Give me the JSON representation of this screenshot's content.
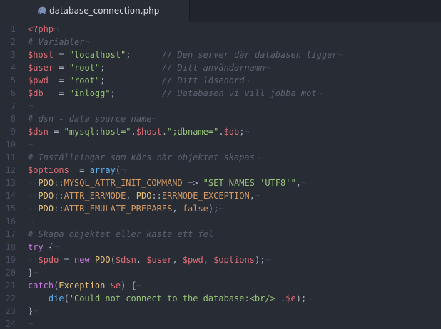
{
  "colors": {
    "background": "#282c34",
    "tabbar": "#21252b",
    "line_number": "#495162",
    "variable": "#e06c75",
    "string": "#98c379",
    "comment": "#5c6370",
    "keyword": "#c678dd",
    "function": "#61afef",
    "class": "#e5c07b",
    "constant": "#d19a66",
    "plain": "#abb2bf",
    "invisible": "#3b4048"
  },
  "tab": {
    "icon": "php-elephant-icon",
    "title": "database_connection.php"
  },
  "editor": {
    "eol_marker": "¬",
    "lines": [
      {
        "n": "1",
        "tokens": [
          {
            "c": "t-php",
            "t": "<?php"
          }
        ]
      },
      {
        "n": "2",
        "tokens": [
          {
            "c": "t-com",
            "t": "# Variabler"
          }
        ]
      },
      {
        "n": "3",
        "tokens": [
          {
            "c": "t-var",
            "t": "$host"
          },
          {
            "c": "t-op",
            "t": " = "
          },
          {
            "c": "t-str",
            "t": "\"localhost\""
          },
          {
            "c": "t-op",
            "t": ";      "
          },
          {
            "c": "t-com",
            "t": "// Den server där databasen ligger"
          }
        ]
      },
      {
        "n": "4",
        "tokens": [
          {
            "c": "t-var",
            "t": "$user"
          },
          {
            "c": "t-op",
            "t": " = "
          },
          {
            "c": "t-str",
            "t": "\"root\""
          },
          {
            "c": "t-op",
            "t": ";           "
          },
          {
            "c": "t-com",
            "t": "// Ditt användarnamn"
          }
        ]
      },
      {
        "n": "5",
        "tokens": [
          {
            "c": "t-var",
            "t": "$pwd"
          },
          {
            "c": "t-op",
            "t": "  = "
          },
          {
            "c": "t-str",
            "t": "\"root\""
          },
          {
            "c": "t-op",
            "t": ";           "
          },
          {
            "c": "t-com",
            "t": "// Ditt lösenord"
          }
        ]
      },
      {
        "n": "6",
        "tokens": [
          {
            "c": "t-var",
            "t": "$db"
          },
          {
            "c": "t-op",
            "t": "   = "
          },
          {
            "c": "t-str",
            "t": "\"inlogg\""
          },
          {
            "c": "t-op",
            "t": ";         "
          },
          {
            "c": "t-com",
            "t": "// Databasen vi vill jobba mot"
          }
        ]
      },
      {
        "n": "7",
        "tokens": []
      },
      {
        "n": "8",
        "tokens": [
          {
            "c": "t-com",
            "t": "# dsn - data source name"
          }
        ]
      },
      {
        "n": "9",
        "tokens": [
          {
            "c": "t-var",
            "t": "$dsn"
          },
          {
            "c": "t-op",
            "t": " = "
          },
          {
            "c": "t-str",
            "t": "\"mysql:host=\""
          },
          {
            "c": "t-op",
            "t": "."
          },
          {
            "c": "t-var",
            "t": "$host"
          },
          {
            "c": "t-op",
            "t": "."
          },
          {
            "c": "t-str",
            "t": "\";dbname=\""
          },
          {
            "c": "t-op",
            "t": "."
          },
          {
            "c": "t-var",
            "t": "$db"
          },
          {
            "c": "t-op",
            "t": ";"
          }
        ]
      },
      {
        "n": "10",
        "tokens": []
      },
      {
        "n": "11",
        "tokens": [
          {
            "c": "t-com",
            "t": "# Inställningar som körs när objektet skapas"
          }
        ]
      },
      {
        "n": "12",
        "tokens": [
          {
            "c": "t-var",
            "t": "$options"
          },
          {
            "c": "t-op",
            "t": "  = "
          },
          {
            "c": "t-fn",
            "t": "array"
          },
          {
            "c": "t-op",
            "t": "("
          }
        ]
      },
      {
        "n": "13",
        "indent": 1,
        "tokens": [
          {
            "c": "t-cls",
            "t": "PDO"
          },
          {
            "c": "t-op",
            "t": "::"
          },
          {
            "c": "t-const",
            "t": "MYSQL_ATTR_INIT_COMMAND"
          },
          {
            "c": "t-op",
            "t": " => "
          },
          {
            "c": "t-str",
            "t": "\"SET NAMES 'UTF8'\""
          },
          {
            "c": "t-op",
            "t": ","
          }
        ]
      },
      {
        "n": "14",
        "indent": 1,
        "tokens": [
          {
            "c": "t-cls",
            "t": "PDO"
          },
          {
            "c": "t-op",
            "t": "::"
          },
          {
            "c": "t-const",
            "t": "ATTR_ERRMODE"
          },
          {
            "c": "t-op",
            "t": ", "
          },
          {
            "c": "t-cls",
            "t": "PDO"
          },
          {
            "c": "t-op",
            "t": "::"
          },
          {
            "c": "t-const",
            "t": "ERRMODE_EXCEPTION"
          },
          {
            "c": "t-op",
            "t": ","
          }
        ]
      },
      {
        "n": "15",
        "indent": 1,
        "tokens": [
          {
            "c": "t-cls",
            "t": "PDO"
          },
          {
            "c": "t-op",
            "t": "::"
          },
          {
            "c": "t-const",
            "t": "ATTR_EMULATE_PREPARES"
          },
          {
            "c": "t-op",
            "t": ", "
          },
          {
            "c": "t-const",
            "t": "false"
          },
          {
            "c": "t-op",
            "t": ");"
          }
        ]
      },
      {
        "n": "16",
        "tokens": []
      },
      {
        "n": "17",
        "tokens": [
          {
            "c": "t-com",
            "t": "# Skapa objektet eller kasta ett fel"
          }
        ]
      },
      {
        "n": "18",
        "tokens": [
          {
            "c": "t-kw",
            "t": "try"
          },
          {
            "c": "t-op",
            "t": " {"
          }
        ]
      },
      {
        "n": "19",
        "indent": 1,
        "tokens": [
          {
            "c": "t-var",
            "t": "$pdo"
          },
          {
            "c": "t-op",
            "t": " = "
          },
          {
            "c": "t-kw",
            "t": "new"
          },
          {
            "c": "t-op",
            "t": " "
          },
          {
            "c": "t-cls",
            "t": "PDO"
          },
          {
            "c": "t-op",
            "t": "("
          },
          {
            "c": "t-var",
            "t": "$dsn"
          },
          {
            "c": "t-op",
            "t": ", "
          },
          {
            "c": "t-var",
            "t": "$user"
          },
          {
            "c": "t-op",
            "t": ", "
          },
          {
            "c": "t-var",
            "t": "$pwd"
          },
          {
            "c": "t-op",
            "t": ", "
          },
          {
            "c": "t-var",
            "t": "$options"
          },
          {
            "c": "t-op",
            "t": ");"
          }
        ]
      },
      {
        "n": "20",
        "tokens": [
          {
            "c": "t-op",
            "t": "}"
          }
        ]
      },
      {
        "n": "21",
        "tokens": [
          {
            "c": "t-kw",
            "t": "catch"
          },
          {
            "c": "t-op",
            "t": "("
          },
          {
            "c": "t-cls",
            "t": "Exception"
          },
          {
            "c": "t-op",
            "t": " "
          },
          {
            "c": "t-var",
            "t": "$e"
          },
          {
            "c": "t-op",
            "t": ") {"
          }
        ]
      },
      {
        "n": "22",
        "indent": 2,
        "tokens": [
          {
            "c": "t-fn",
            "t": "die"
          },
          {
            "c": "t-op",
            "t": "("
          },
          {
            "c": "t-str",
            "t": "'Could not connect to the database:<br/>'"
          },
          {
            "c": "t-op",
            "t": "."
          },
          {
            "c": "t-var",
            "t": "$e"
          },
          {
            "c": "t-op",
            "t": ");"
          }
        ]
      },
      {
        "n": "23",
        "tokens": [
          {
            "c": "t-op",
            "t": "}"
          }
        ]
      },
      {
        "n": "24",
        "tokens": []
      }
    ]
  }
}
